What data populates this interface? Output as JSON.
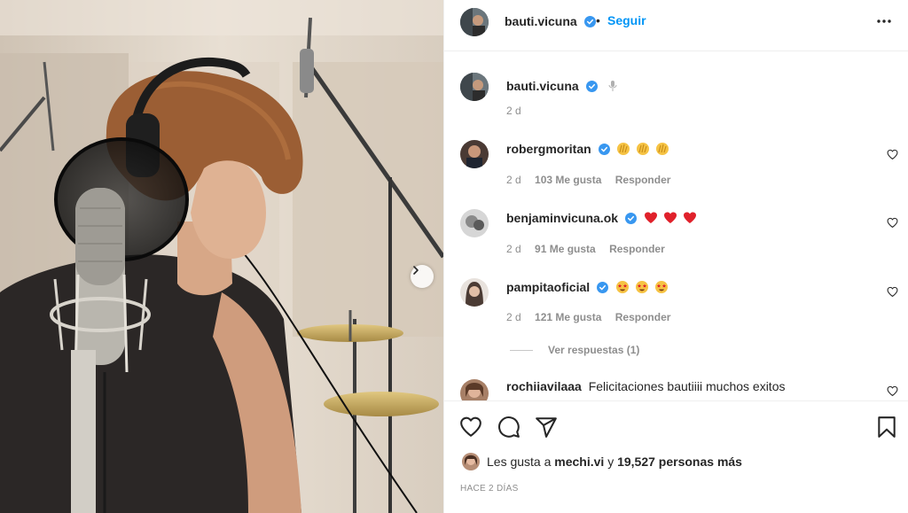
{
  "post": {
    "author": "bauti.vicuna",
    "follow_label": "Seguir",
    "dot": "•"
  },
  "caption": {
    "username": "bauti.vicuna",
    "emoji_icon": "microphone-icon",
    "time": "2 d"
  },
  "comments": [
    {
      "username": "robergmoritan",
      "text": "",
      "emojis": [
        "clap",
        "clap",
        "clap"
      ],
      "time": "2 d",
      "likes": "103 Me gusta",
      "reply": "Responder"
    },
    {
      "username": "benjaminvicuna.ok",
      "text": "",
      "emojis": [
        "heart",
        "heart",
        "heart"
      ],
      "time": "2 d",
      "likes": "91 Me gusta",
      "reply": "Responder"
    },
    {
      "username": "pampitaoficial",
      "text": "",
      "emojis": [
        "star-eyes",
        "star-eyes",
        "star-eyes"
      ],
      "time": "2 d",
      "likes": "121 Me gusta",
      "reply": "Responder"
    },
    {
      "username": "rochiiavilaaa",
      "text": "Felicitaciones bautiiii muchos exitos"
    }
  ],
  "view_replies": "Ver respuestas (1)",
  "likes_bar": {
    "prefix": "Les gusta a",
    "user": "mechi.vi",
    "connector": "y",
    "count_text": "19,527 personas más"
  },
  "timestamp": "HACE 2 DÍAS",
  "colors": {
    "accent": "#0095f6",
    "text": "#262626",
    "muted": "#8e8e8e",
    "heart_red": "#ed4956"
  }
}
